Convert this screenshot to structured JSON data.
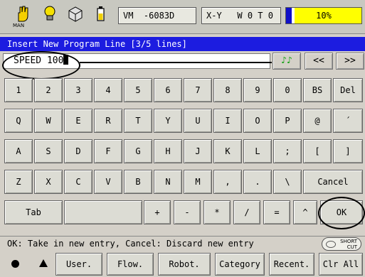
{
  "status": {
    "icons": [
      {
        "name": "hand-icon",
        "caption": "MAN"
      },
      {
        "name": "bulb-icon",
        "caption": ""
      },
      {
        "name": "cube-icon",
        "caption": ""
      },
      {
        "name": "battery-icon",
        "caption": ""
      }
    ],
    "coord_system": "VM",
    "value": "-6083D",
    "frame": "X-Y",
    "frame_values": "W 0 T 0",
    "speed_percent": 10,
    "speed_label": "10%",
    "colors": {
      "blue": "#1010c8",
      "yellow": "#ffff00"
    }
  },
  "title": "Insert New Program Line [3/5 lines]",
  "input": {
    "value": "SPEED 100"
  },
  "nav": {
    "music": "♪♪",
    "prev": "<<",
    "next": ">>"
  },
  "keyboard": {
    "row1": [
      "1",
      "2",
      "3",
      "4",
      "5",
      "6",
      "7",
      "8",
      "9",
      "0",
      "BS",
      "Del"
    ],
    "row2": [
      "Q",
      "W",
      "E",
      "R",
      "T",
      "Y",
      "U",
      "I",
      "O",
      "P",
      "@",
      "´"
    ],
    "row3": [
      "A",
      "S",
      "D",
      "F",
      "G",
      "H",
      "J",
      "K",
      "L",
      ";",
      "[",
      "]"
    ],
    "row4": [
      "Z",
      "X",
      "C",
      "V",
      "B",
      "N",
      "M",
      ",",
      ".",
      "\\",
      "Cancel"
    ],
    "row5": [
      "Tab",
      "",
      "+",
      "-",
      "*",
      "/",
      "=",
      "^",
      "OK"
    ]
  },
  "message": "OK: Take in new entry, Cancel: Discard new entry",
  "shortcut": {
    "line1": "SHORT",
    "line2": "CUT"
  },
  "menu": [
    "User.",
    "Flow.",
    "Robot.",
    "Category",
    "Recent.",
    "Clr All"
  ]
}
